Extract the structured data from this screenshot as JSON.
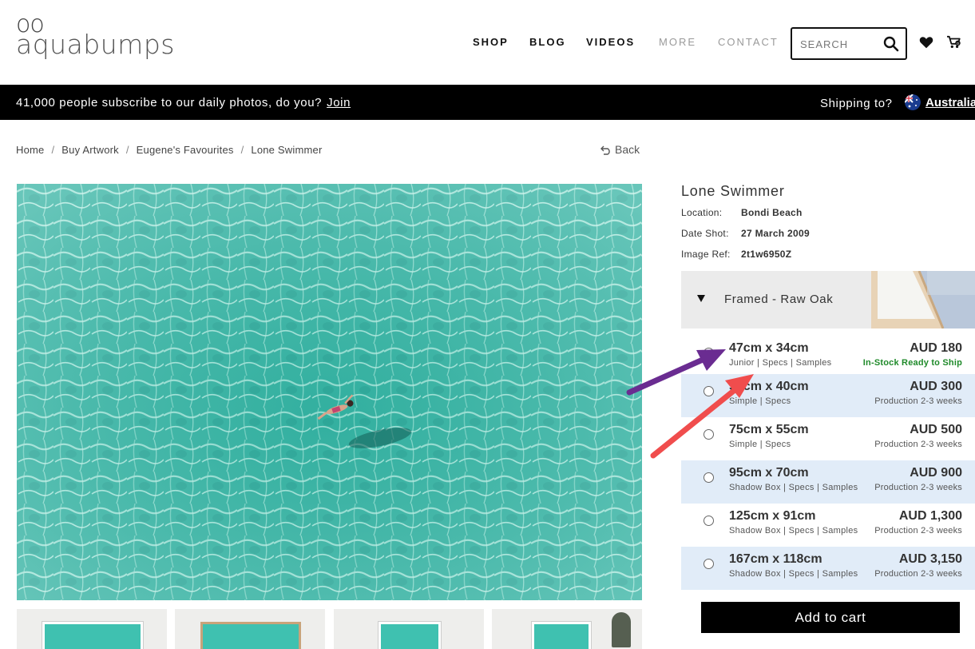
{
  "brand": {
    "logo_dots": "oo",
    "logo_word": "aquabumps"
  },
  "nav": {
    "shop": "SHOP",
    "blog": "BLOG",
    "videos": "VIDEOS",
    "more": "MORE",
    "contact": "CONTACT"
  },
  "search": {
    "placeholder": "SEARCH"
  },
  "banner": {
    "message": "41,000 people subscribe to our daily photos, do you?",
    "join": "Join",
    "shipping_label": "Shipping to?",
    "country": "Australia"
  },
  "breadcrumb": {
    "items": [
      "Home",
      "Buy Artwork",
      "Eugene's Favourites",
      "Lone Swimmer"
    ],
    "separator": "/"
  },
  "back_label": "Back",
  "product": {
    "title": "Lone Swimmer",
    "location_label": "Location:",
    "location": "Bondi Beach",
    "date_label": "Date Shot:",
    "date": "27 March 2009",
    "ref_label": "Image Ref:",
    "ref": "2t1w6950Z"
  },
  "frame": {
    "selected": "Framed - Raw Oak"
  },
  "options": [
    {
      "size": "47cm x 34cm",
      "sub": "Junior | Specs | Samples",
      "price": "AUD 180",
      "status": "In-Stock Ready to Ship"
    },
    {
      "size": "52cm x 40cm",
      "sub": "Simple | Specs",
      "price": "AUD 300",
      "status": "Production 2-3 weeks"
    },
    {
      "size": "75cm x 55cm",
      "sub": "Simple | Specs",
      "price": "AUD 500",
      "status": "Production 2-3 weeks"
    },
    {
      "size": "95cm x 70cm",
      "sub": "Shadow Box | Specs | Samples",
      "price": "AUD 900",
      "status": "Production 2-3 weeks"
    },
    {
      "size": "125cm x 91cm",
      "sub": "Shadow Box | Specs | Samples",
      "price": "AUD 1,300",
      "status": "Production 2-3 weeks"
    },
    {
      "size": "167cm x 118cm",
      "sub": "Shadow Box | Specs | Samples",
      "price": "AUD 3,150",
      "status": "Production 2-3 weeks"
    }
  ],
  "add_to_cart": "Add to cart",
  "colors": {
    "banner_bg": "#000000",
    "row_alt": "#e1ecf8",
    "in_stock": "#1f8a2a",
    "arrow_purple": "#6a2c91",
    "arrow_red": "#f04d4d",
    "water": "#3fc1b0"
  },
  "icons": [
    "search-icon",
    "heart-icon",
    "cart-icon",
    "australia-flag-icon",
    "back-arrow-icon",
    "dropdown-triangle-icon"
  ]
}
